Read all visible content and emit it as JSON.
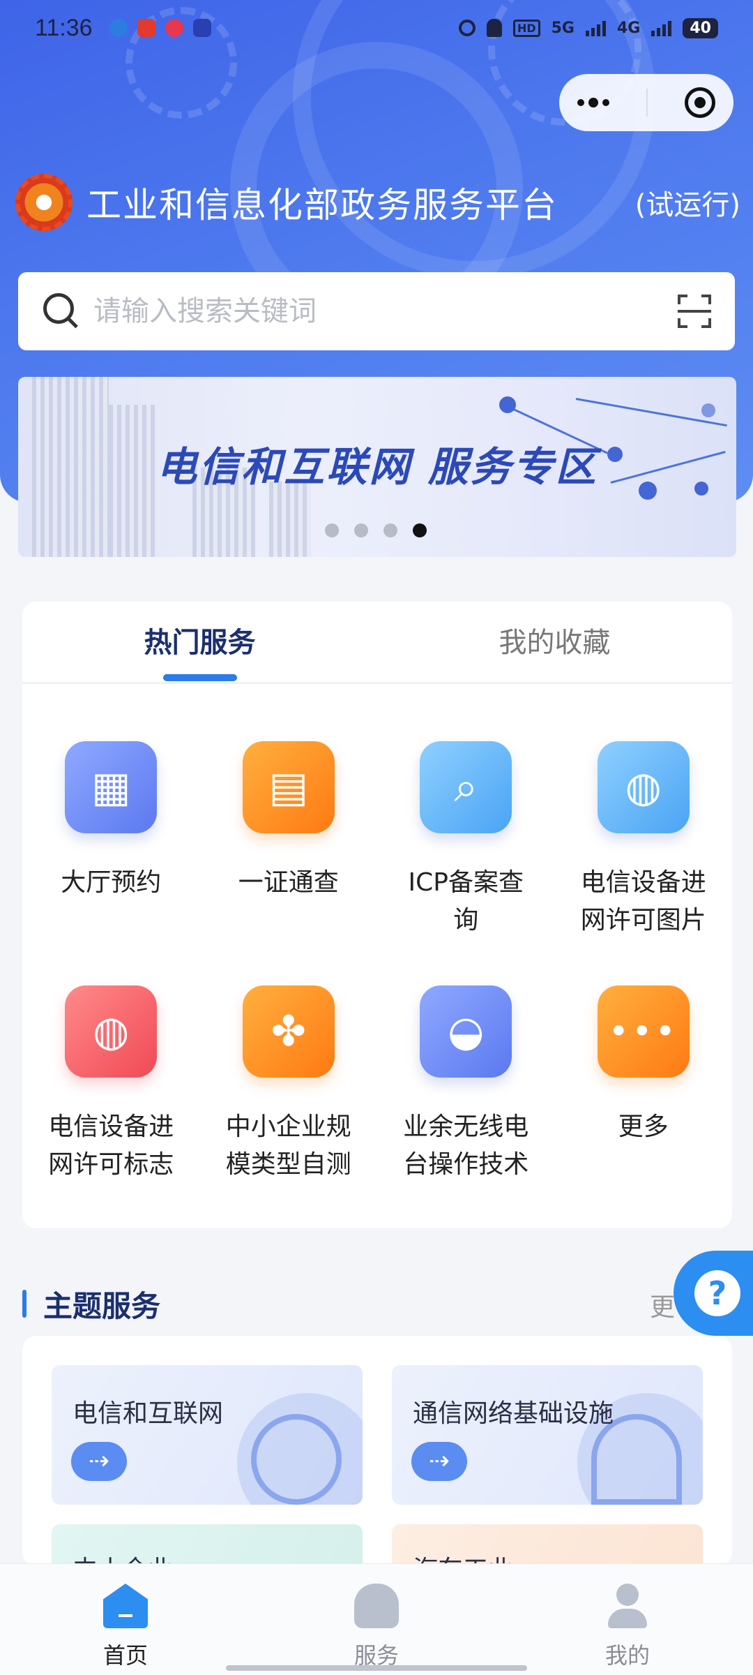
{
  "status_bar": {
    "time": "11:36",
    "network_1": "5G",
    "network_2": "4G",
    "battery": "40"
  },
  "header": {
    "title": "工业和信息化部政务服务平台",
    "subtitle": "(试运行)"
  },
  "search": {
    "placeholder": "请输入搜索关键词"
  },
  "banner": {
    "text": "电信和互联网 服务专区",
    "dots": 4,
    "active_dot": 4
  },
  "services_card": {
    "tabs": [
      {
        "label": "热门服务",
        "active": true
      },
      {
        "label": "我的收藏",
        "active": false
      }
    ],
    "items": [
      {
        "label": "大厅预约",
        "icon": "calendar-icon",
        "color": "#6b86f4"
      },
      {
        "label": "一证通查",
        "icon": "id-card-icon",
        "color": "#ff8c1f"
      },
      {
        "label": "ICP备案查询",
        "icon": "search-document-icon",
        "color": "#5fb2f7"
      },
      {
        "label": "电信设备进网许可图片",
        "icon": "globe-image-icon",
        "color": "#5fb2f7"
      },
      {
        "label": "电信设备进网许可标志",
        "icon": "globe-badge-icon",
        "color": "#f2565f"
      },
      {
        "label": "中小企业规模类型自测",
        "icon": "chart-grid-icon",
        "color": "#ff8c1f"
      },
      {
        "label": "业余无线电台操作技术",
        "icon": "satellite-dish-icon",
        "color": "#6b86f4"
      },
      {
        "label": "更多",
        "icon": "more-icon",
        "color": "#ff8c1f"
      }
    ]
  },
  "theme_section": {
    "title": "主题服务",
    "more": "更",
    "cards": [
      {
        "label": "电信和互联网"
      },
      {
        "label": "通信网络基础设施"
      },
      {
        "label": "中小企业"
      },
      {
        "label": "汽车工业"
      }
    ]
  },
  "bottom_nav": {
    "items": [
      {
        "label": "首页",
        "active": true
      },
      {
        "label": "服务",
        "active": false
      },
      {
        "label": "我的",
        "active": false
      }
    ]
  },
  "colors": {
    "accent": "#2b7be8",
    "header_bg": "#4a72ec",
    "title_dark": "#1b2f6e"
  }
}
